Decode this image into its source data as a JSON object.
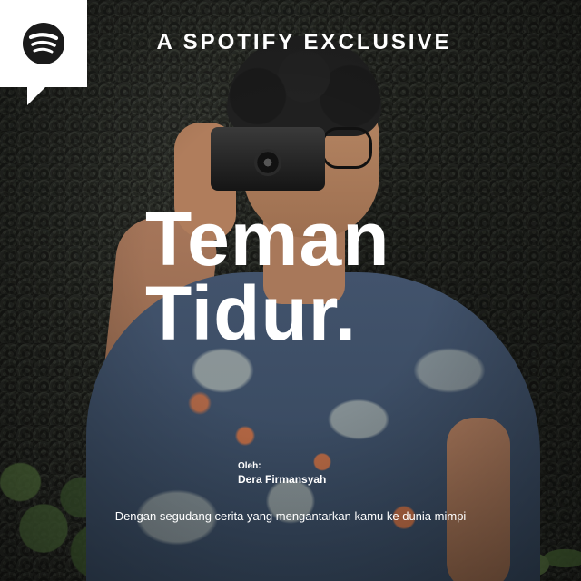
{
  "header": {
    "exclusive_label": "A SPOTIFY EXCLUSIVE"
  },
  "badge": {
    "logo_icon": "spotify-logo-icon",
    "background_color": "#ffffff",
    "logo_color": "#1a1a1a"
  },
  "show": {
    "title_line1": "Teman",
    "title_line2": "Tidur.",
    "by_label": "Oleh:",
    "author": "Dera Firmansyah",
    "description": "Dengan segudang cerita yang mengantarkan kamu ke dunia mimpi"
  },
  "colors": {
    "text": "#ffffff"
  }
}
